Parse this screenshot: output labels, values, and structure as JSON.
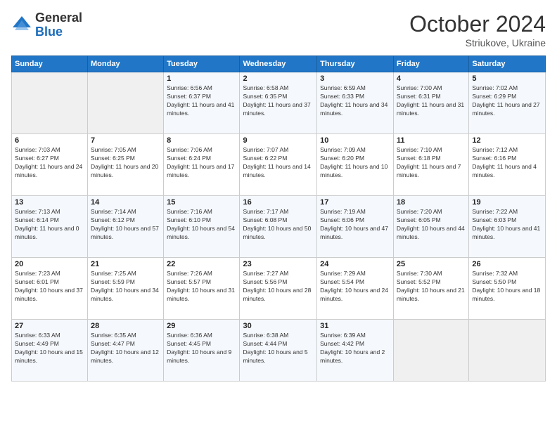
{
  "logo": {
    "general": "General",
    "blue": "Blue"
  },
  "title": "October 2024",
  "subtitle": "Striukove, Ukraine",
  "days_header": [
    "Sunday",
    "Monday",
    "Tuesday",
    "Wednesday",
    "Thursday",
    "Friday",
    "Saturday"
  ],
  "weeks": [
    [
      {
        "day": "",
        "info": ""
      },
      {
        "day": "",
        "info": ""
      },
      {
        "day": "1",
        "info": "Sunrise: 6:56 AM\nSunset: 6:37 PM\nDaylight: 11 hours and 41 minutes."
      },
      {
        "day": "2",
        "info": "Sunrise: 6:58 AM\nSunset: 6:35 PM\nDaylight: 11 hours and 37 minutes."
      },
      {
        "day": "3",
        "info": "Sunrise: 6:59 AM\nSunset: 6:33 PM\nDaylight: 11 hours and 34 minutes."
      },
      {
        "day": "4",
        "info": "Sunrise: 7:00 AM\nSunset: 6:31 PM\nDaylight: 11 hours and 31 minutes."
      },
      {
        "day": "5",
        "info": "Sunrise: 7:02 AM\nSunset: 6:29 PM\nDaylight: 11 hours and 27 minutes."
      }
    ],
    [
      {
        "day": "6",
        "info": "Sunrise: 7:03 AM\nSunset: 6:27 PM\nDaylight: 11 hours and 24 minutes."
      },
      {
        "day": "7",
        "info": "Sunrise: 7:05 AM\nSunset: 6:25 PM\nDaylight: 11 hours and 20 minutes."
      },
      {
        "day": "8",
        "info": "Sunrise: 7:06 AM\nSunset: 6:24 PM\nDaylight: 11 hours and 17 minutes."
      },
      {
        "day": "9",
        "info": "Sunrise: 7:07 AM\nSunset: 6:22 PM\nDaylight: 11 hours and 14 minutes."
      },
      {
        "day": "10",
        "info": "Sunrise: 7:09 AM\nSunset: 6:20 PM\nDaylight: 11 hours and 10 minutes."
      },
      {
        "day": "11",
        "info": "Sunrise: 7:10 AM\nSunset: 6:18 PM\nDaylight: 11 hours and 7 minutes."
      },
      {
        "day": "12",
        "info": "Sunrise: 7:12 AM\nSunset: 6:16 PM\nDaylight: 11 hours and 4 minutes."
      }
    ],
    [
      {
        "day": "13",
        "info": "Sunrise: 7:13 AM\nSunset: 6:14 PM\nDaylight: 11 hours and 0 minutes."
      },
      {
        "day": "14",
        "info": "Sunrise: 7:14 AM\nSunset: 6:12 PM\nDaylight: 10 hours and 57 minutes."
      },
      {
        "day": "15",
        "info": "Sunrise: 7:16 AM\nSunset: 6:10 PM\nDaylight: 10 hours and 54 minutes."
      },
      {
        "day": "16",
        "info": "Sunrise: 7:17 AM\nSunset: 6:08 PM\nDaylight: 10 hours and 50 minutes."
      },
      {
        "day": "17",
        "info": "Sunrise: 7:19 AM\nSunset: 6:06 PM\nDaylight: 10 hours and 47 minutes."
      },
      {
        "day": "18",
        "info": "Sunrise: 7:20 AM\nSunset: 6:05 PM\nDaylight: 10 hours and 44 minutes."
      },
      {
        "day": "19",
        "info": "Sunrise: 7:22 AM\nSunset: 6:03 PM\nDaylight: 10 hours and 41 minutes."
      }
    ],
    [
      {
        "day": "20",
        "info": "Sunrise: 7:23 AM\nSunset: 6:01 PM\nDaylight: 10 hours and 37 minutes."
      },
      {
        "day": "21",
        "info": "Sunrise: 7:25 AM\nSunset: 5:59 PM\nDaylight: 10 hours and 34 minutes."
      },
      {
        "day": "22",
        "info": "Sunrise: 7:26 AM\nSunset: 5:57 PM\nDaylight: 10 hours and 31 minutes."
      },
      {
        "day": "23",
        "info": "Sunrise: 7:27 AM\nSunset: 5:56 PM\nDaylight: 10 hours and 28 minutes."
      },
      {
        "day": "24",
        "info": "Sunrise: 7:29 AM\nSunset: 5:54 PM\nDaylight: 10 hours and 24 minutes."
      },
      {
        "day": "25",
        "info": "Sunrise: 7:30 AM\nSunset: 5:52 PM\nDaylight: 10 hours and 21 minutes."
      },
      {
        "day": "26",
        "info": "Sunrise: 7:32 AM\nSunset: 5:50 PM\nDaylight: 10 hours and 18 minutes."
      }
    ],
    [
      {
        "day": "27",
        "info": "Sunrise: 6:33 AM\nSunset: 4:49 PM\nDaylight: 10 hours and 15 minutes."
      },
      {
        "day": "28",
        "info": "Sunrise: 6:35 AM\nSunset: 4:47 PM\nDaylight: 10 hours and 12 minutes."
      },
      {
        "day": "29",
        "info": "Sunrise: 6:36 AM\nSunset: 4:45 PM\nDaylight: 10 hours and 9 minutes."
      },
      {
        "day": "30",
        "info": "Sunrise: 6:38 AM\nSunset: 4:44 PM\nDaylight: 10 hours and 5 minutes."
      },
      {
        "day": "31",
        "info": "Sunrise: 6:39 AM\nSunset: 4:42 PM\nDaylight: 10 hours and 2 minutes."
      },
      {
        "day": "",
        "info": ""
      },
      {
        "day": "",
        "info": ""
      }
    ]
  ]
}
